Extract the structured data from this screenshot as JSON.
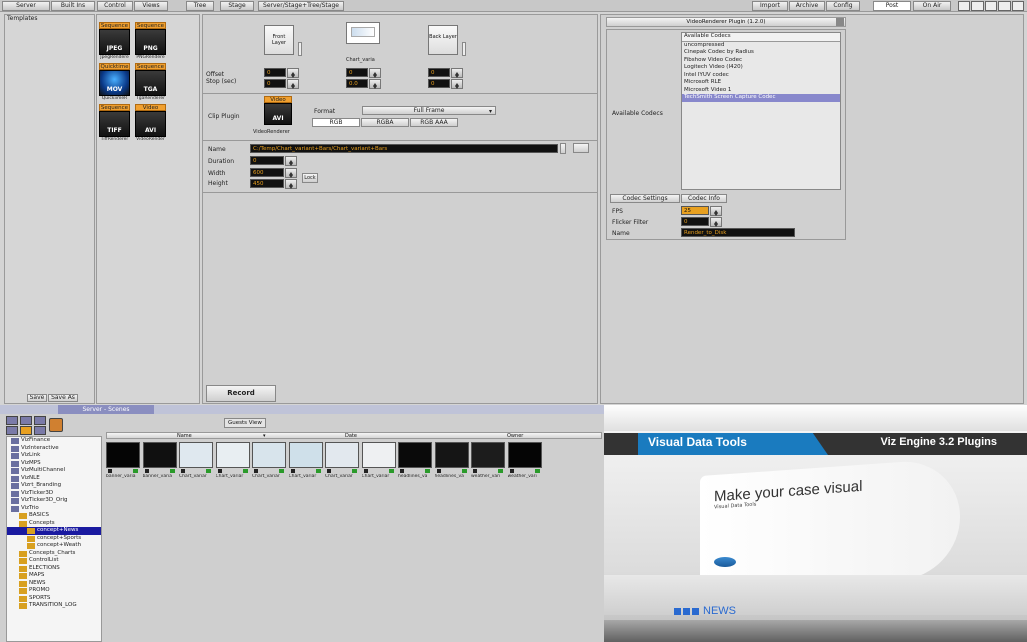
{
  "toolbar": {
    "left": [
      "Server",
      "Built Ins",
      "Control",
      "Views",
      "Tree",
      "Stage",
      "Server/Stage+Tree/Stage"
    ],
    "right": [
      "Import",
      "Archive",
      "Config",
      "Post",
      "On Air"
    ]
  },
  "templates": {
    "title": "Templates",
    "save": "Save",
    "save_as": "Save As",
    "items": [
      {
        "top": "Sequence",
        "fmt": "JPEG",
        "name": "JpegRendere"
      },
      {
        "top": "Sequence",
        "fmt": "PNG",
        "name": "PNGRendere"
      },
      {
        "top": "Quicktime",
        "fmt": "MOV",
        "name": "QuickiimeR"
      },
      {
        "top": "Sequence",
        "fmt": "TGA",
        "name": "TgaRenderer"
      },
      {
        "top": "Sequence",
        "fmt": "TIFF",
        "name": "TiffRenderer"
      },
      {
        "top": "Video",
        "fmt": "AVI",
        "name": "VideoRender"
      }
    ]
  },
  "layers": {
    "front": "Front Layer",
    "back": "Back Layer",
    "chart": "Chart_varia",
    "offset": "Offset",
    "stop": "Stop (sec)",
    "offset_vals": [
      "0",
      "0",
      "0"
    ],
    "stop_vals": [
      "0",
      "0.0",
      "0"
    ]
  },
  "clip": {
    "label": "Clip Plugin",
    "plugin_top": "Video",
    "plugin_fmt": "AVI",
    "plugin_name": "VideoRenderer",
    "format_label": "Format",
    "format_value": "Full Frame",
    "color_modes": [
      "RGB",
      "RGBA",
      "RGB AAA"
    ]
  },
  "render": {
    "name_label": "Name",
    "name_value": "C:/Temp/Chart_variant+Bars/Chart_variant+Bars",
    "duration_label": "Duration",
    "duration": "0",
    "width_label": "Width",
    "width": "600",
    "height_label": "Height",
    "height": "450",
    "lock": "Lock",
    "record": "Record"
  },
  "plugin": {
    "title": "VideoRenderer Plugin (1.2.0)",
    "codecs_label": "Available Codecs",
    "codecs_header": "Available Codecs",
    "codecs": [
      "uncompressed",
      "Cinepak Codec by Radius",
      "Fibshow Video Codec",
      "Logitech Video (I420)",
      "Intel IYUV codec",
      "Microsoft RLE",
      "Microsoft Video 1",
      "TechSmith Screen Capture Codec"
    ],
    "codec_settings": "Codec Settings",
    "codec_info": "Codec Info",
    "fps_label": "FPS",
    "fps": "25",
    "flicker_label": "Flicker Filter",
    "flicker": "0",
    "name_label": "Name",
    "name": "Render_to_Disk"
  },
  "scenes": {
    "tab": "Server - Scenes",
    "guests": "Guests View",
    "columns": [
      "Name",
      "Date",
      "Owner"
    ],
    "tree": [
      {
        "label": "VizFinance",
        "indent": 0,
        "sel": false
      },
      {
        "label": "VizInteractive",
        "indent": 0,
        "sel": false
      },
      {
        "label": "VizLink",
        "indent": 0,
        "sel": false
      },
      {
        "label": "VizMPS",
        "indent": 0,
        "sel": false
      },
      {
        "label": "VizMultiChannel",
        "indent": 0,
        "sel": false
      },
      {
        "label": "VizNLE",
        "indent": 0,
        "sel": false
      },
      {
        "label": "Vizrt_Branding",
        "indent": 0,
        "sel": false
      },
      {
        "label": "VizTicker3D",
        "indent": 0,
        "sel": false
      },
      {
        "label": "VizTicker3D_Orig",
        "indent": 0,
        "sel": false
      },
      {
        "label": "VizTrio",
        "indent": 0,
        "sel": false
      },
      {
        "label": "BASICS",
        "indent": 1,
        "sel": false
      },
      {
        "label": "Concepts",
        "indent": 1,
        "sel": false
      },
      {
        "label": "concept+News",
        "indent": 2,
        "sel": true
      },
      {
        "label": "concept+Sports",
        "indent": 2,
        "sel": false
      },
      {
        "label": "concept+Weath",
        "indent": 2,
        "sel": false
      },
      {
        "label": "Concepts_Charts",
        "indent": 1,
        "sel": false
      },
      {
        "label": "ControlList",
        "indent": 1,
        "sel": false
      },
      {
        "label": "ELECTIONS",
        "indent": 1,
        "sel": false
      },
      {
        "label": "MAPS",
        "indent": 1,
        "sel": false
      },
      {
        "label": "NEWS",
        "indent": 1,
        "sel": false
      },
      {
        "label": "PROMO",
        "indent": 1,
        "sel": false
      },
      {
        "label": "SPORTS",
        "indent": 1,
        "sel": false
      },
      {
        "label": "TRANSITION_LOG",
        "indent": 1,
        "sel": false
      }
    ],
    "thumbs": [
      {
        "name": "banner_varia",
        "color": "#050505"
      },
      {
        "name": "banner_varia",
        "color": "#101010"
      },
      {
        "name": "Chart_variar",
        "color": "#dfe8ef"
      },
      {
        "name": "Chart_variar",
        "color": "#e8eef2"
      },
      {
        "name": "Chart_variar",
        "color": "#d8e4ec"
      },
      {
        "name": "Chart_variar",
        "color": "#cfe0ea"
      },
      {
        "name": "Chart_variar",
        "color": "#e2e8ee"
      },
      {
        "name": "Chart_variar",
        "color": "#eef0f2"
      },
      {
        "name": "headlines_va",
        "color": "#0a0a0a"
      },
      {
        "name": "headlines_va",
        "color": "#151515"
      },
      {
        "name": "weather_vari",
        "color": "#1c1c1c"
      },
      {
        "name": "weather_vari",
        "color": "#050505"
      }
    ]
  },
  "preview": {
    "brand": "Visual Data Tools",
    "product": "Viz Engine 3.2 Plugins",
    "headline": "Make your case visual",
    "sub": "Visual Data Tools",
    "news": "NEWS"
  }
}
